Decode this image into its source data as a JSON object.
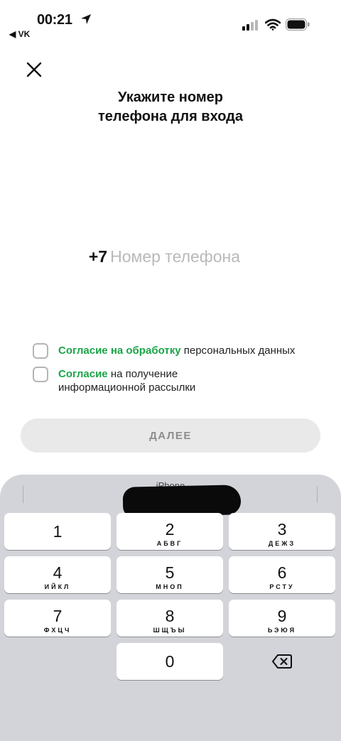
{
  "status_bar": {
    "time": "00:21",
    "back_app": "VK"
  },
  "title": {
    "line1": "Укажите номер",
    "line2": "телефона для входа"
  },
  "phone": {
    "prefix": "+7",
    "placeholder": "Номер телефона",
    "value": ""
  },
  "consents": [
    {
      "link": "Согласие на обработку",
      "text": " персональных данных"
    },
    {
      "link": "Согласие",
      "text": " на получение информационной рассылки"
    }
  ],
  "next_label": "ДАЛЕЕ",
  "keyboard": {
    "label": "iPhone",
    "keys": [
      {
        "digit": "1",
        "letters": ""
      },
      {
        "digit": "2",
        "letters": "АБВГ"
      },
      {
        "digit": "3",
        "letters": "ДЕЖЗ"
      },
      {
        "digit": "4",
        "letters": "ИЙКЛ"
      },
      {
        "digit": "5",
        "letters": "МНОП"
      },
      {
        "digit": "6",
        "letters": "РСТУ"
      },
      {
        "digit": "7",
        "letters": "ФХЦЧ"
      },
      {
        "digit": "8",
        "letters": "ШЩЪЫ"
      },
      {
        "digit": "9",
        "letters": "ЬЭЮЯ"
      },
      {
        "digit": "0",
        "letters": ""
      }
    ]
  },
  "colors": {
    "accent_green": "#1aa447",
    "keyboard_bg": "#d3d4d9",
    "button_disabled_bg": "#e9e9e9"
  },
  "icons": [
    "location-arrow-icon",
    "back-arrow-icon",
    "signal-icon",
    "wifi-icon",
    "battery-icon",
    "close-icon",
    "delete-icon"
  ]
}
